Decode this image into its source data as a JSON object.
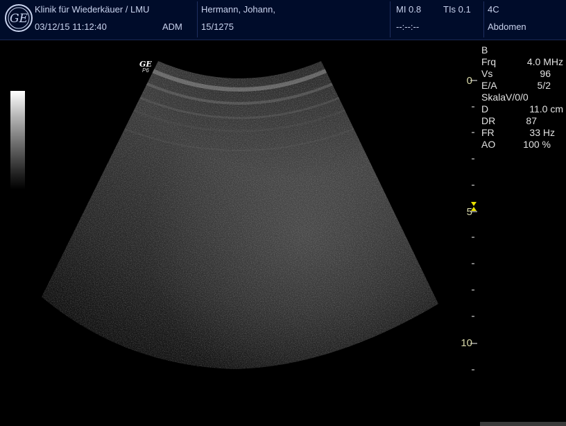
{
  "header": {
    "institution": "Klinik für Wiederkäuer / LMU",
    "datetime": "03/12/15 11:12:40",
    "operator": "ADM",
    "patient_name": "Hermann, Johann,",
    "patient_id": "15/1275",
    "mi": "MI 0.8",
    "tis": "TIs 0.1",
    "time_placeholder": "--:--:--",
    "probe": "4C",
    "preset": "Abdomen"
  },
  "logo": {
    "icon": "ge-logo-icon",
    "text": "GE"
  },
  "image_marks": {
    "brand": "GE",
    "probe_code": "P6"
  },
  "parameters": {
    "mode": "B",
    "rows": [
      {
        "key": "Frq",
        "value": "4.0 MHz"
      },
      {
        "key": "Vs",
        "value": "96"
      },
      {
        "key": "E/A",
        "value": "5/2"
      },
      {
        "key": "SkalaV/0/0",
        "value": ""
      },
      {
        "key": "D",
        "value": "11.0 cm"
      },
      {
        "key": "DR",
        "value": "87"
      },
      {
        "key": "FR",
        "value": "33 Hz"
      },
      {
        "key": "AO",
        "value": "100 %"
      }
    ]
  },
  "depth_scale": {
    "labels": [
      "0",
      "5",
      "10"
    ],
    "focus_marker_depth_cm": 5
  },
  "colors": {
    "header_bg": "#000c2a",
    "depth_scale": "#d7d7a8",
    "focus_marker": "#e8e000"
  }
}
